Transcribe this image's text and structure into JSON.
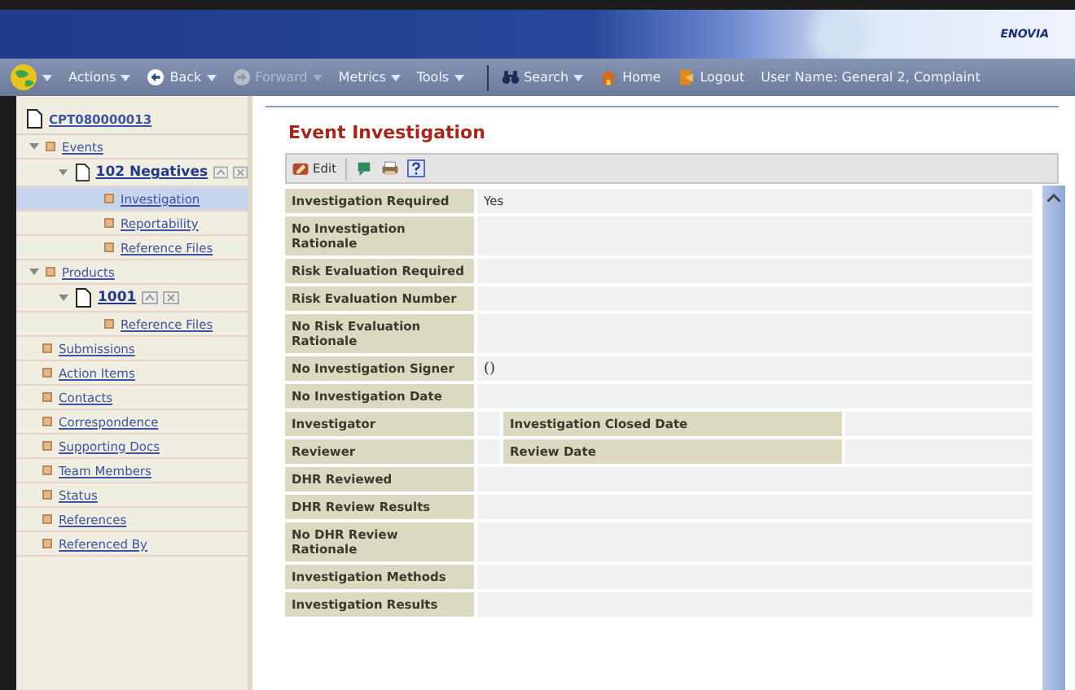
{
  "banner": {
    "logo": "ENOVIA"
  },
  "toolbar": {
    "items": [
      {
        "kind": "globe",
        "dropdown": true,
        "disabled": false
      },
      {
        "kind": "menu",
        "label": "Actions",
        "dropdown": true,
        "disabled": false
      },
      {
        "kind": "back",
        "label": "Back",
        "dropdown": true,
        "disabled": false
      },
      {
        "kind": "forward",
        "label": "Forward",
        "dropdown": true,
        "disabled": true
      },
      {
        "kind": "menu",
        "label": "Metrics",
        "dropdown": true,
        "disabled": false
      },
      {
        "kind": "menu",
        "label": "Tools",
        "dropdown": true,
        "disabled": false
      },
      {
        "kind": "separator"
      },
      {
        "kind": "search",
        "label": "Search",
        "dropdown": true,
        "disabled": false
      },
      {
        "kind": "home",
        "label": "Home",
        "dropdown": false,
        "disabled": false
      },
      {
        "kind": "logout",
        "label": "Logout",
        "dropdown": false,
        "disabled": false
      }
    ],
    "user": "User Name: General 2, Complaint"
  },
  "sidebar": {
    "root": "CPT080000013",
    "items": [
      {
        "kind": "folder",
        "label": "Events",
        "expanded": true,
        "selected": false,
        "children": [
          {
            "kind": "document",
            "label": "102 Negatives",
            "expanded": true,
            "selected": false,
            "children": [
              {
                "kind": "leaf",
                "label": "Investigation",
                "selected": true
              },
              {
                "kind": "leaf",
                "label": "Reportability",
                "selected": false
              },
              {
                "kind": "leaf",
                "label": "Reference Files",
                "selected": false
              }
            ]
          }
        ]
      },
      {
        "kind": "folder",
        "label": "Products",
        "expanded": true,
        "selected": false,
        "children": [
          {
            "kind": "document",
            "label": "1001",
            "expanded": true,
            "selected": false,
            "children": [
              {
                "kind": "leaf",
                "label": "Reference Files",
                "selected": false
              }
            ]
          }
        ]
      },
      {
        "kind": "leaf",
        "label": "Submissions",
        "selected": false
      },
      {
        "kind": "leaf",
        "label": "Action Items",
        "selected": false
      },
      {
        "kind": "leaf",
        "label": "Contacts",
        "selected": false
      },
      {
        "kind": "leaf",
        "label": "Correspondence",
        "selected": false
      },
      {
        "kind": "leaf",
        "label": "Supporting Docs",
        "selected": false
      },
      {
        "kind": "leaf",
        "label": "Team Members",
        "selected": false
      },
      {
        "kind": "leaf",
        "label": "Status",
        "selected": false
      },
      {
        "kind": "leaf",
        "label": "References",
        "selected": false
      },
      {
        "kind": "leaf",
        "label": "Referenced By",
        "selected": false
      }
    ]
  },
  "page": {
    "title": "Event Investigation",
    "actions": [
      {
        "kind": "edit",
        "label": "Edit"
      },
      {
        "kind": "comment"
      },
      {
        "kind": "print"
      },
      {
        "kind": "help"
      }
    ]
  },
  "form": {
    "rows": [
      {
        "kind": "single",
        "label": "Investigation Required",
        "value": "Yes"
      },
      {
        "kind": "single",
        "label": "No Investigation Rationale"
      },
      {
        "kind": "single",
        "label": "Risk Evaluation Required"
      },
      {
        "kind": "single",
        "label": "Risk Evaluation Number"
      },
      {
        "kind": "single",
        "label": "No Risk Evaluation Rationale"
      },
      {
        "kind": "single",
        "label": "No Investigation Signer",
        "value": "()"
      },
      {
        "kind": "single",
        "label": "No Investigation Date"
      },
      {
        "kind": "pair",
        "label": "Investigator",
        "label2": "Investigation Closed Date"
      },
      {
        "kind": "pair",
        "label": "Reviewer",
        "label2": "Review Date"
      },
      {
        "kind": "single",
        "label": "DHR Reviewed"
      },
      {
        "kind": "single",
        "label": "DHR Review Results"
      },
      {
        "kind": "single",
        "label": "No DHR Review Rationale"
      },
      {
        "kind": "single",
        "label": "Investigation Methods"
      },
      {
        "kind": "single",
        "label": "Investigation Results"
      }
    ]
  }
}
